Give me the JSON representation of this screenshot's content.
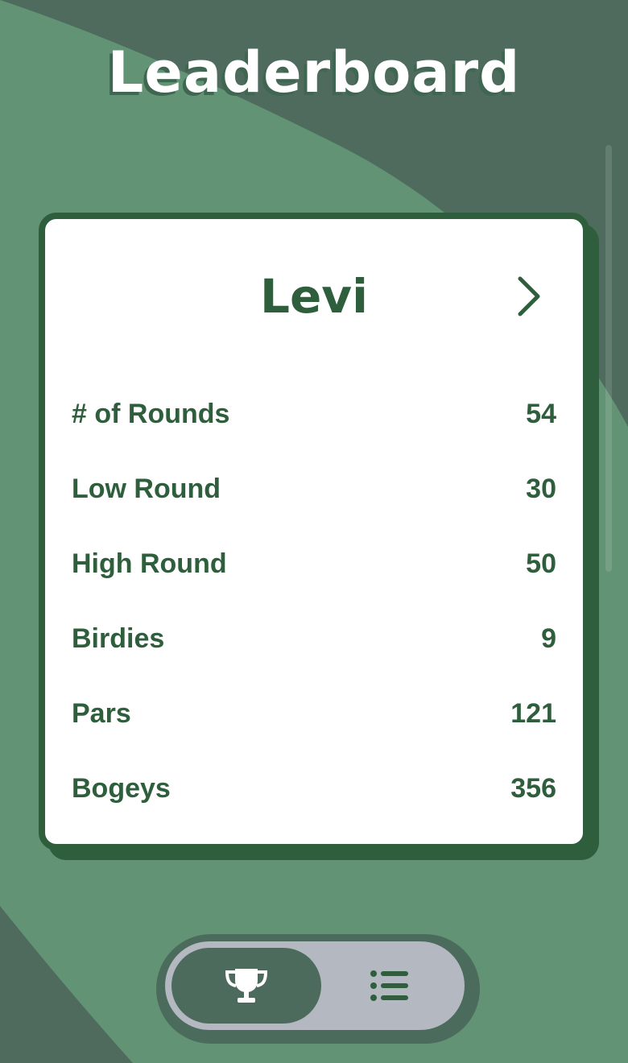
{
  "header": {
    "title": "Leaderboard"
  },
  "card": {
    "player_name": "Levi",
    "next_icon": "chevron-right-icon",
    "stats": [
      {
        "label": "# of Rounds",
        "value": "54"
      },
      {
        "label": "Low Round",
        "value": "30"
      },
      {
        "label": "High Round",
        "value": "50"
      },
      {
        "label": "Birdies",
        "value": "9"
      },
      {
        "label": "Pars",
        "value": "121"
      },
      {
        "label": "Bogeys",
        "value": "356"
      }
    ]
  },
  "nav": {
    "items": [
      {
        "icon": "trophy-icon",
        "active": true
      },
      {
        "icon": "list-icon",
        "active": false
      }
    ]
  },
  "colors": {
    "background": "#629375",
    "dark_green": "#4e6b5d",
    "accent": "#2e5e3c",
    "card": "#ffffff",
    "nav_pill": "#b4b8c0"
  }
}
